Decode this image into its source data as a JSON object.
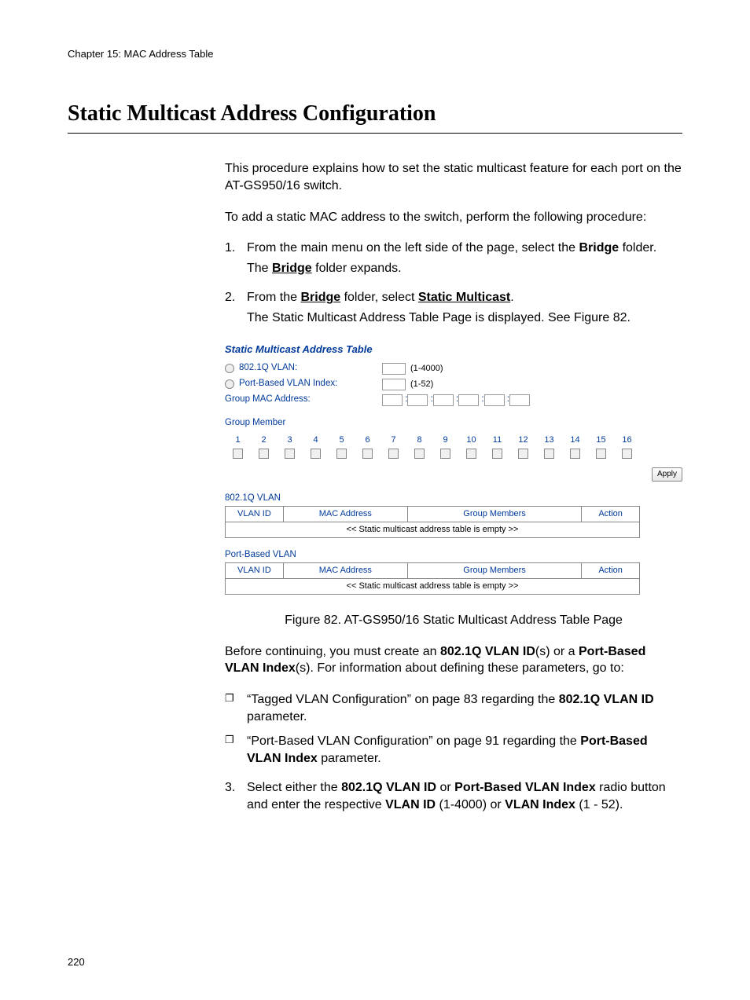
{
  "chapter": "Chapter 15: MAC Address Table",
  "title": "Static Multicast Address Configuration",
  "intro1": "This procedure explains how to set the static multicast feature for each port on the AT-GS950/16 switch.",
  "intro2": "To add a static MAC address to the switch, perform the following procedure:",
  "steps": {
    "s1": {
      "n": "1.",
      "a": "From the main menu on the left side of the page, select the ",
      "bridge": "Bridge",
      "b": " folder.",
      "c1": "The ",
      "c2": "Bridge",
      "c3": " folder expands."
    },
    "s2": {
      "n": "2.",
      "a": "From the ",
      "b": "Bridge",
      "c": " folder, select ",
      "d": "Static Multicast",
      "e": ".",
      "f": "The Static Multicast Address Table Page is displayed. See Figure 82."
    },
    "s3": {
      "n": "3.",
      "a": "Select either the ",
      "b": "802.1Q VLAN ID",
      "c": " or ",
      "d": "Port-Based VLAN Index",
      "e": " radio button and enter the respective ",
      "f": "VLAN ID",
      "g": " (1-4000) or ",
      "h": "VLAN Index",
      "i": " (1 - 52)."
    }
  },
  "fig": {
    "title": "Static Multicast Address Table",
    "r1": "802.1Q VLAN:",
    "r1hint": "(1-4000)",
    "r2": "Port-Based VLAN Index:",
    "r2hint": "(1-52)",
    "r3": "Group MAC Address:",
    "gm": "Group Member",
    "ports": [
      "1",
      "2",
      "3",
      "4",
      "5",
      "6",
      "7",
      "8",
      "9",
      "10",
      "11",
      "12",
      "13",
      "14",
      "15",
      "16"
    ],
    "apply": "Apply",
    "t1": "802.1Q VLAN",
    "t2": "Port-Based VLAN",
    "cols": {
      "vlan": "VLAN ID",
      "mac": "MAC Address",
      "grp": "Group Members",
      "act": "Action"
    },
    "empty": "<< Static multicast address table is empty >>"
  },
  "caption": "Figure 82. AT-GS950/16 Static Multicast Address Table Page",
  "before": {
    "a": "Before continuing, you must create an ",
    "b": "802.1Q VLAN ID",
    "c": "(s) or a ",
    "d": "Port-Based VLAN Index",
    "e": "(s). For information about defining these parameters, go to:"
  },
  "bul": {
    "b1a": "“Tagged VLAN Configuration” on page 83 regarding the ",
    "b1b": "802.1Q VLAN ID",
    "b1c": " parameter.",
    "b2a": "“Port-Based VLAN Configuration” on page 91 regarding the ",
    "b2b": "Port-Based VLAN Index",
    "b2c": " parameter."
  },
  "pagenum": "220"
}
